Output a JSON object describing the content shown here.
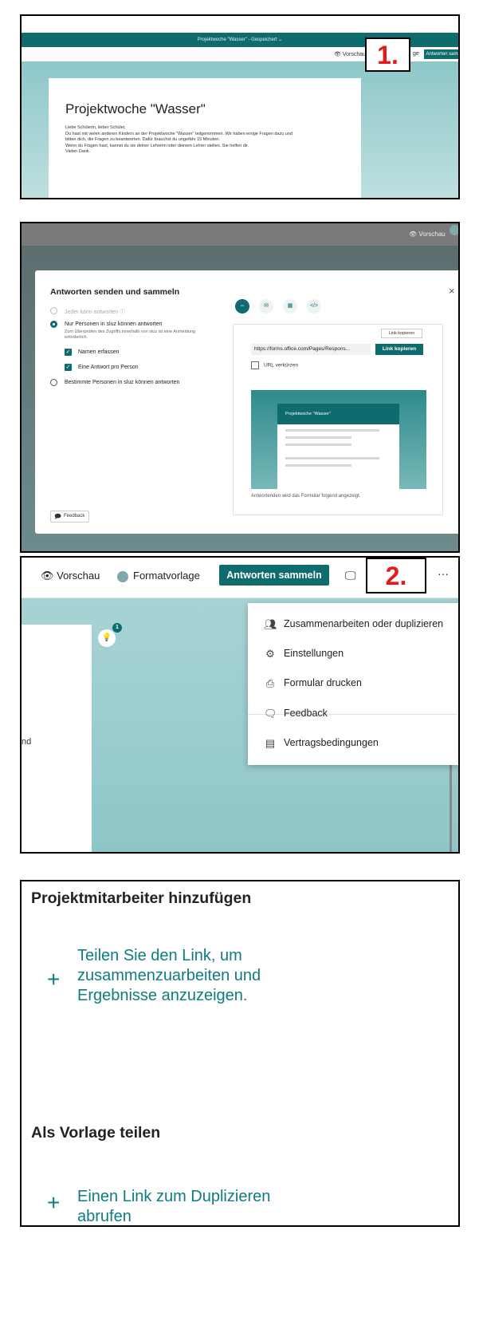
{
  "panel1": {
    "window_title": "Projektwoche \"Wasser\"  -  Gespeichert  ⌄",
    "toolbar": {
      "preview": "Vorschau",
      "tail_label": "ge",
      "collect_button": "Antworten sammeln"
    },
    "form": {
      "title": "Projektwoche \"Wasser\"",
      "description_lines": [
        "Liebe Schülerin, lieber Schüler,",
        "Du hast mit vielen anderen Kindern an der Projektwoche \"Wasser\" teilgenommen. Wir haben einige Fragen dazu und",
        "bitten dich, die Fragen zu beantworten. Dafür brauchst du ungefähr 15 Minuten.",
        "Wenn du Fragen hast, kannst du sie deiner Lehrerin oder deinem Lehrer stellen. Sie helfen dir.",
        "Vielen Dank."
      ]
    },
    "step_badge": "1."
  },
  "panel2": {
    "topbar_preview": "Vorschau",
    "dialog": {
      "title": "Antworten senden und sammeln",
      "close": "×",
      "options": {
        "anyone": "Jeder kann antworten",
        "org_only": "Nur Personen in sluz können antworten",
        "org_only_sub": "Zum Überprüfen des Zugriffs innerhalb von sluz ist eine Anmeldung erforderlich.",
        "record_names": "Namen erfassen",
        "one_response": "Eine Antwort pro Person",
        "specific_people": "Bestimmte Personen in sluz können antworten"
      },
      "feedback": "Feedback",
      "tooltip": "Link kopieren",
      "url": "https://forms.office.com/Pages/Respons...",
      "copy_button": "Link kopieren",
      "shorten_url": "URL verkürzen",
      "preview_title": "Projektwoche \"Wasser\"",
      "preview_note": "Antwortenden wird das Formular folgend angezeigt."
    }
  },
  "panel3": {
    "toolbar": {
      "preview": "Vorschau",
      "style": "Formatvorlage",
      "collect_button": "Antworten sammeln",
      "more": "···"
    },
    "step_badge": "2.",
    "bulb_count": "1",
    "text_fragment": "nd",
    "menu": [
      {
        "label": "Zusammenarbeiten oder duplizieren",
        "icon": "people-icon"
      },
      {
        "label": "Einstellungen",
        "icon": "gear-icon"
      },
      {
        "label": "Formular drucken",
        "icon": "printer-icon"
      },
      {
        "label": "Feedback",
        "icon": "feedback-icon"
      },
      {
        "label": "Vertragsbedingungen",
        "icon": "document-icon"
      }
    ]
  },
  "panel4": {
    "collab_heading": "Projektmitarbeiter hinzufügen",
    "collab_link_lines": [
      "Teilen Sie den Link, um",
      "zusammenzuarbeiten und",
      "Ergebnisse anzuzeigen."
    ],
    "template_heading": "Als Vorlage teilen",
    "template_link_lines": [
      "Einen Link zum Duplizieren",
      "abrufen"
    ]
  },
  "colors": {
    "accent": "#0e6b6e",
    "badge_red": "#e31b1b",
    "link_teal": "#0e7c80"
  }
}
